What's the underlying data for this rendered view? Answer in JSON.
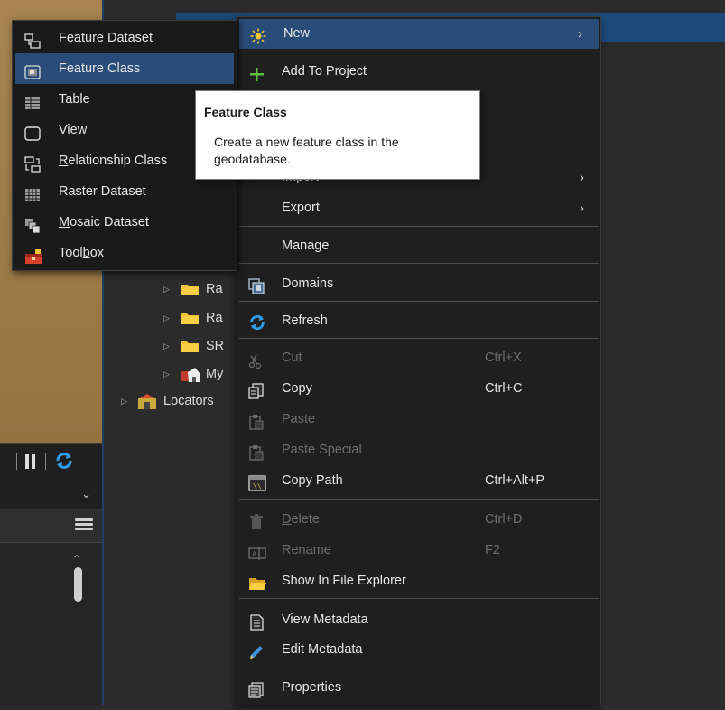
{
  "background": {
    "map_toolbar": {
      "pause_icon": "pause-icon",
      "refresh_icon": "refresh-icon"
    },
    "tree": [
      {
        "label": "Ra",
        "icon": "folder-icon",
        "indent": 2
      },
      {
        "label": "Ra",
        "icon": "folder-icon",
        "indent": 2
      },
      {
        "label": "SR",
        "icon": "folder-icon",
        "indent": 2
      },
      {
        "label": "My",
        "icon": "home-toolbox-icon",
        "indent": 2
      },
      {
        "label": "Locators",
        "icon": "locators-icon",
        "indent": 1
      }
    ]
  },
  "submenu_new": {
    "items": [
      {
        "label": "Feature Dataset",
        "icon": "feature-dataset-icon"
      },
      {
        "label": "Feature Class",
        "icon": "feature-class-icon",
        "active": true
      },
      {
        "label": "Table",
        "icon": "table-icon"
      },
      {
        "pre": "Vie",
        "u": "w",
        "post": "",
        "icon": "view-icon"
      },
      {
        "pre": "",
        "u": "R",
        "post": "elationship Class",
        "icon": "relationship-class-icon"
      },
      {
        "label": "Raster Dataset",
        "icon": "raster-dataset-icon"
      },
      {
        "pre": "",
        "u": "M",
        "post": "osaic Dataset",
        "icon": "mosaic-dataset-icon"
      },
      {
        "pre": "Tool",
        "u": "b",
        "post": "ox",
        "icon": "toolbox-icon"
      }
    ]
  },
  "tooltip": {
    "title": "Feature Class",
    "body": "Create a new feature class in the geodatabase."
  },
  "context_menu": {
    "new": {
      "label": "New",
      "icon": "sun-new-icon"
    },
    "add_to_project": {
      "label": "Add To Project",
      "icon": "plus-icon"
    },
    "import": {
      "label": "Import"
    },
    "export": {
      "label": "Export"
    },
    "manage": {
      "label": "Manage"
    },
    "domains": {
      "label": "Domains",
      "icon": "domains-icon"
    },
    "refresh": {
      "label": "Refresh",
      "icon": "refresh-icon"
    },
    "cut": {
      "label": "Cut",
      "shortcut": "Ctrl+X",
      "disabled": true
    },
    "copy": {
      "label": "Copy",
      "shortcut": "Ctrl+C"
    },
    "paste": {
      "label": "Paste",
      "disabled": true
    },
    "paste_special": {
      "label": "Paste Special",
      "disabled": true
    },
    "copy_path": {
      "label": "Copy Path",
      "shortcut": "Ctrl+Alt+P"
    },
    "delete": {
      "pre": "",
      "u": "D",
      "post": "elete",
      "shortcut": "Ctrl+D",
      "disabled": true
    },
    "rename": {
      "label": "Rename",
      "shortcut": "F2",
      "disabled": true
    },
    "show_in_explorer": {
      "label": "Show In File Explorer",
      "icon": "folder-open-icon"
    },
    "view_metadata": {
      "label": "View Metadata",
      "icon": "metadata-document-icon"
    },
    "edit_metadata": {
      "label": "Edit Metadata",
      "icon": "pencil-icon"
    },
    "properties": {
      "label": "Properties",
      "icon": "properties-icon"
    }
  },
  "colors": {
    "menu_bg": "#1f1f1f",
    "highlight": "#294d78",
    "selection_strip": "#1d4a7a",
    "disabled_text": "#6e6e6e",
    "tooltip_bg": "#ffffff"
  }
}
